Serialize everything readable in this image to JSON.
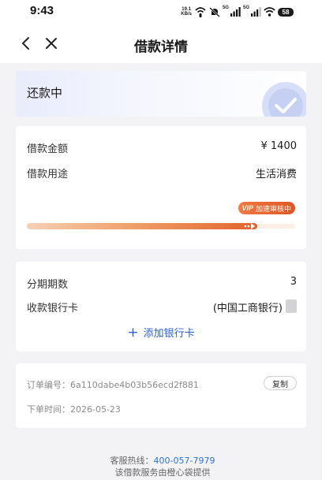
{
  "status_bar": {
    "time": "9:43",
    "net_speed_value": "19.1",
    "net_speed_unit": "KB/s",
    "signal_label_1": "5G",
    "signal_label_2": "5G",
    "battery": "58",
    "icons": [
      "wifi-calling-icon",
      "mute-icon",
      "signal-icon",
      "signal-icon",
      "wifi-icon",
      "battery-icon"
    ]
  },
  "nav": {
    "title": "借款详情",
    "back_icon": "chevron-left-icon",
    "close_icon": "close-icon"
  },
  "status_card": {
    "label": "还款中",
    "icon": "check-circle-icon"
  },
  "loan": {
    "amount_label": "借款金额",
    "amount_value": "¥ 1400",
    "purpose_label": "借款用途",
    "purpose_value": "生活消费",
    "badge_vip": "VIP",
    "badge_text": "加速审核中",
    "progress": 0.86
  },
  "bank": {
    "installments_label": "分期期数",
    "installments_value": "3",
    "card_label": "收款银行卡",
    "card_value": "(中国工商银行)",
    "add_card_icon": "plus-icon",
    "add_card_label": "添加银行卡"
  },
  "order": {
    "number_text": "订单编号：6a110dabe4b03b56ecd2f881",
    "copy_label": "复制",
    "time_text": "下单时间：2026-05-23"
  },
  "footer": {
    "hotline_label": "客服热线：",
    "hotline_number": "400-057-7979",
    "provider_text": "该借款服务由橙心袋提供"
  },
  "colors": {
    "accent_orange": "#e3551f",
    "link_blue": "#2b5fd9",
    "background": "#f3f3f5"
  }
}
